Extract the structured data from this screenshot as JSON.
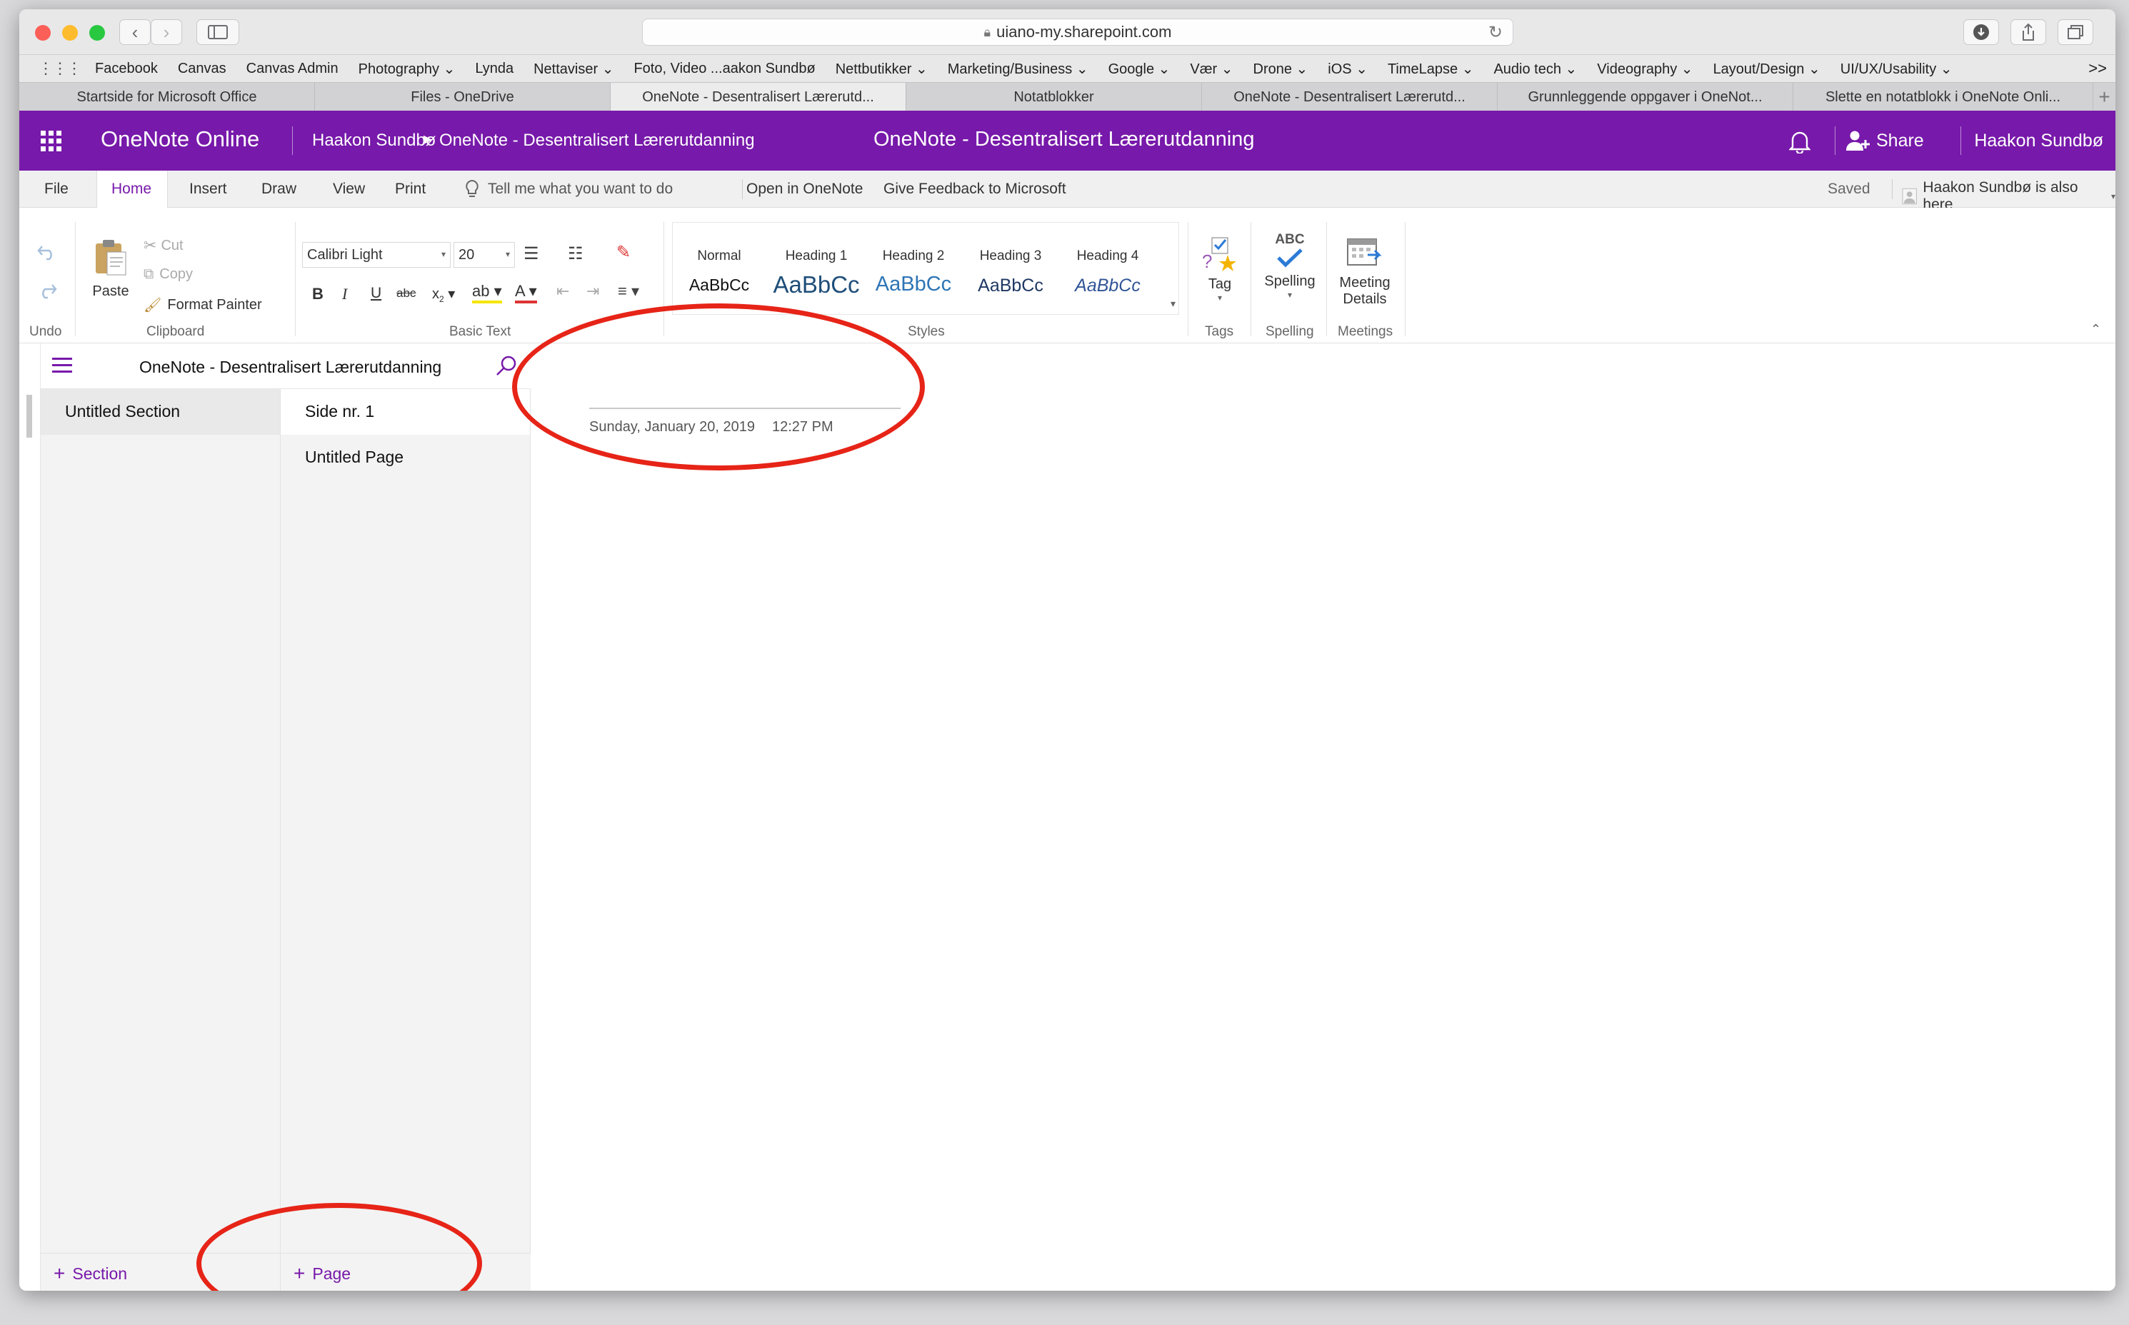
{
  "browser": {
    "url": "uiano-my.sharepoint.com",
    "favorites": [
      "Facebook",
      "Canvas",
      "Canvas Admin",
      "Photography ⌄",
      "Lynda",
      "Nettaviser ⌄",
      "Foto, Video ...aakon Sundbø",
      "Nettbutikker ⌄",
      "Marketing/Business ⌄",
      "Google ⌄",
      "Vær ⌄",
      "Drone ⌄",
      "iOS ⌄",
      "TimeLapse ⌄",
      "Audio tech ⌄",
      "Videography ⌄",
      "Layout/Design ⌄",
      "UI/UX/Usability ⌄"
    ],
    "overflow": ">>",
    "tabs": [
      "Startside for Microsoft Office",
      "Files - OneDrive",
      "OneNote - Desentralisert Lærerutd...",
      "Notatblokker",
      "OneNote - Desentralisert Lærerutd...",
      "Grunnleggende oppgaver i OneNot...",
      "Slette en notatblokk i OneNote Onli..."
    ],
    "new_tab": "+"
  },
  "header": {
    "app_name": "OneNote Online",
    "breadcrumb_user": "Haakon Sundbø",
    "breadcrumb_notebook": "OneNote - Desentralisert Lærerutdanning",
    "title": "OneNote - Desentralisert Lærerutdanning",
    "share": "Share",
    "user": "Haakon Sundbø"
  },
  "ribbon_tabs": {
    "file": "File",
    "home": "Home",
    "insert": "Insert",
    "draw": "Draw",
    "view": "View",
    "print": "Print",
    "tell_me": "Tell me what you want to do",
    "open_in": "Open in OneNote",
    "feedback": "Give Feedback to Microsoft",
    "saved": "Saved",
    "presence": "Haakon Sundbø is also here"
  },
  "ribbon": {
    "undo_label": "Undo",
    "paste": "Paste",
    "cut": "Cut",
    "copy": "Copy",
    "format_painter": "Format Painter",
    "clipboard_label": "Clipboard",
    "font": "Calibri Light",
    "font_size": "20",
    "basic_text_label": "Basic Text",
    "styles": [
      {
        "name": "Normal",
        "sample": "AaBbCc"
      },
      {
        "name": "Heading 1",
        "sample": "AaBbCc"
      },
      {
        "name": "Heading 2",
        "sample": "AaBbCc"
      },
      {
        "name": "Heading 3",
        "sample": "AaBbCc"
      },
      {
        "name": "Heading 4",
        "sample": "AaBbCc"
      }
    ],
    "styles_label": "Styles",
    "tag": "Tag",
    "tags_label": "Tags",
    "spelling_abc": "ABC",
    "spelling": "Spelling",
    "spelling_label": "Spelling",
    "meeting_line1": "Meeting",
    "meeting_line2": "Details",
    "meetings_label": "Meetings"
  },
  "nav": {
    "notebook": "OneNote - Desentralisert Lærerutdanning",
    "sections": [
      "Untitled Section"
    ],
    "pages": [
      "Side nr. 1",
      "Untitled Page"
    ],
    "add_section": "Section",
    "add_page": "Page"
  },
  "page": {
    "date": "Sunday, January 20, 2019",
    "time": "12:27 PM"
  },
  "colors": {
    "brand": "#7719aa",
    "annotation": "#e62417"
  }
}
